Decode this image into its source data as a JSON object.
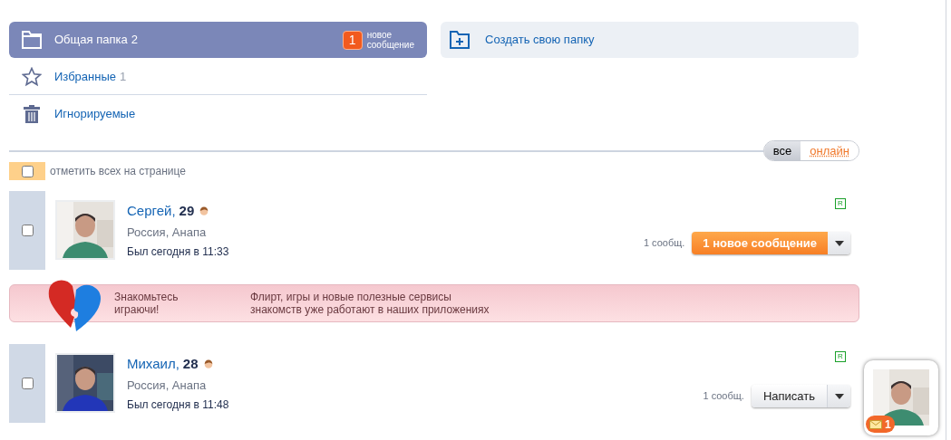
{
  "folders": [
    {
      "kind": "folder",
      "label": "Общая папка",
      "count": "2",
      "selected": true,
      "badge": {
        "count": "1",
        "lines": [
          "новое",
          "сообщение"
        ]
      }
    },
    {
      "kind": "star",
      "label": "Избранные",
      "count": "1",
      "selected": false
    },
    {
      "kind": "trash",
      "label": "Игнорируемые",
      "selected": false
    }
  ],
  "create_folder": {
    "label": "Создать свою папку"
  },
  "filter": [
    {
      "label": "все",
      "selected": true
    },
    {
      "label": "онлайн",
      "selected": false
    }
  ],
  "select_all": {
    "label": "отметить всех на странице",
    "checked": false
  },
  "contacts": [
    {
      "name": "Сергей,",
      "age": "29",
      "location": "Россия, Анапа",
      "last_seen": "Был сегодня в 11:33",
      "mark": "R",
      "messages": "1 сообщ.",
      "action": {
        "kind": "new",
        "label": "1 новое сообщение"
      },
      "checked": false
    },
    {
      "kind": "banner",
      "title_lines": [
        "Знакомьтесь",
        "играючи!"
      ],
      "text_lines": [
        "Флирт, игры и новые полезные сервисы",
        "знакомств уже работают в наших приложениях"
      ]
    },
    {
      "name": "Михаил,",
      "age": "28",
      "location": "Россия, Анапа",
      "last_seen": "Был сегодня в 11:48",
      "mark": "R",
      "messages": "1 сообщ.",
      "action": {
        "kind": "write",
        "label": "Написать"
      },
      "checked": false
    }
  ],
  "notification": {
    "count": "1"
  }
}
